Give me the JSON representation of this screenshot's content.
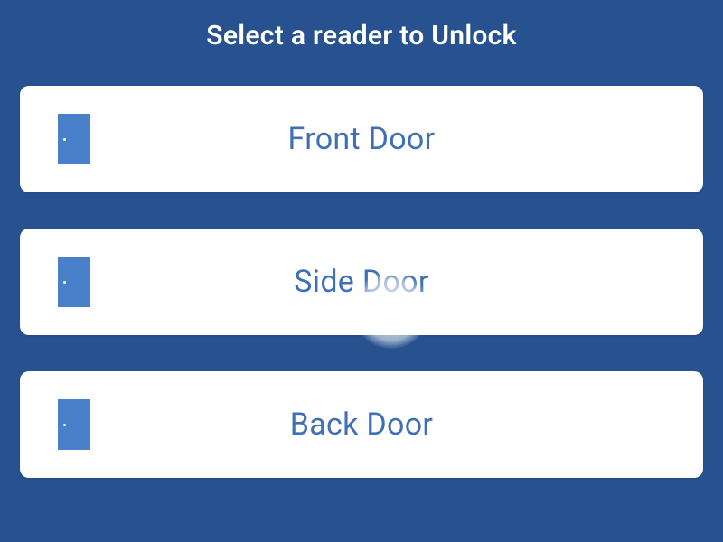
{
  "header": {
    "title": "Select a reader to Unlock"
  },
  "readers": [
    {
      "label": "Front Door",
      "icon": "door-icon"
    },
    {
      "label": "Side Door",
      "icon": "door-icon"
    },
    {
      "label": "Back Door",
      "icon": "door-icon"
    }
  ],
  "colors": {
    "background": "#27528f",
    "card": "#ffffff",
    "accent": "#4a7fc9",
    "label": "#3f6fb5"
  }
}
